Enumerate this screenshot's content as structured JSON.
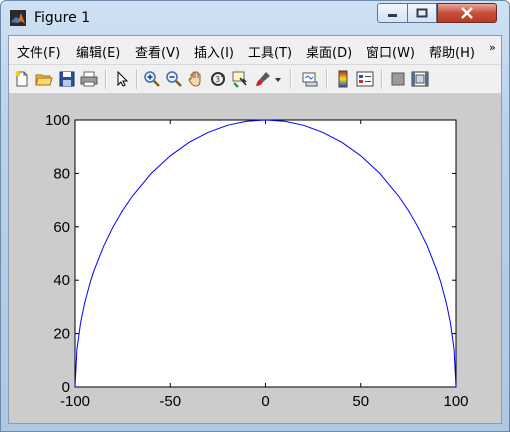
{
  "window": {
    "title": "Figure 1",
    "controls": [
      "minimize-icon",
      "maximize-icon",
      "close-icon"
    ]
  },
  "menu": {
    "items": [
      "文件(F)",
      "编辑(E)",
      "查看(V)",
      "插入(I)",
      "工具(T)",
      "桌面(D)",
      "窗口(W)",
      "帮助(H)"
    ],
    "overflow": "»"
  },
  "toolbar": {
    "icons": [
      "new-figure-icon",
      "open-file-icon",
      "save-icon",
      "print-icon",
      "pointer-icon",
      "zoom-in-icon",
      "zoom-out-icon",
      "pan-hand-icon",
      "rotate-3d-icon",
      "data-cursor-icon",
      "brush-icon",
      "brush-dropdown-icon",
      "link-plot-icon",
      "colorbar-icon",
      "legend-icon",
      "hide-plot-tools-icon",
      "show-plot-tools-icon"
    ]
  },
  "colors": {
    "line": "#0000ff",
    "axes_background": "#ffffff",
    "figure_background": "#cccccc"
  },
  "chart_data": {
    "type": "line",
    "title": "",
    "xlabel": "",
    "ylabel": "",
    "xlim": [
      -100,
      100
    ],
    "ylim": [
      0,
      100
    ],
    "xticks": [
      -100,
      -50,
      0,
      50,
      100
    ],
    "yticks": [
      0,
      20,
      40,
      60,
      80,
      100
    ],
    "xtick_labels": [
      "-100",
      "-50",
      "0",
      "50",
      "100"
    ],
    "ytick_labels": [
      "0",
      "20",
      "40",
      "60",
      "80",
      "100"
    ],
    "grid": false,
    "series": [
      {
        "x": [
          -100,
          -99,
          -97,
          -95,
          -92,
          -90,
          -85,
          -80,
          -75,
          -70,
          -60,
          -50,
          -40,
          -30,
          -20,
          -10,
          0,
          10,
          20,
          30,
          40,
          50,
          60,
          70,
          75,
          80,
          85,
          90,
          92,
          95,
          97,
          99,
          100
        ],
        "y": [
          0,
          14.1,
          24.3,
          31.2,
          39.2,
          43.6,
          52.7,
          60,
          66.1,
          71.4,
          80,
          86.6,
          91.7,
          95.4,
          98,
          99.5,
          100,
          99.5,
          98,
          95.4,
          91.7,
          86.6,
          80,
          71.4,
          66.1,
          60,
          52.7,
          43.6,
          39.2,
          31.2,
          24.3,
          14.1,
          0
        ]
      }
    ]
  }
}
